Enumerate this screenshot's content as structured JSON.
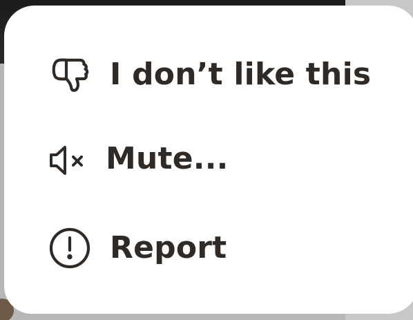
{
  "menu": {
    "items": [
      {
        "label": "I don’t like this",
        "icon": "thumbs-down-icon"
      },
      {
        "label": "Mute...",
        "icon": "mute-icon"
      },
      {
        "label": "Report",
        "icon": "alert-circle-icon"
      }
    ]
  },
  "colors": {
    "menu_background": "#ffffff",
    "text": "#2f2a26",
    "dim_background": "#b7b7b7"
  }
}
